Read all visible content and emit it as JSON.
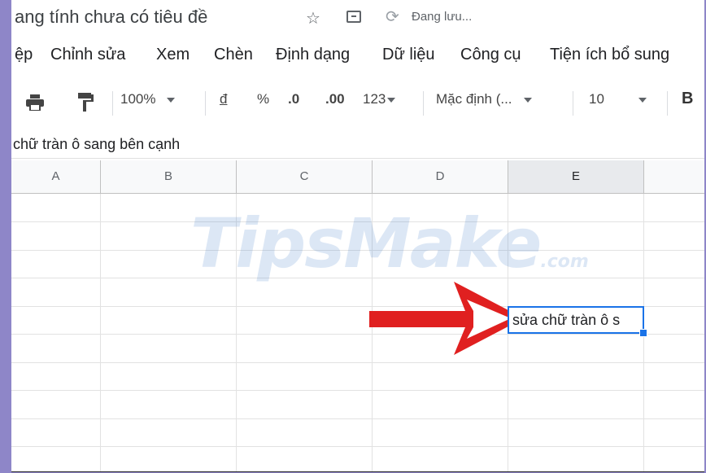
{
  "title_bar": {
    "doc_title": "ang tính chưa có tiêu đề",
    "save_status": "Đang lưu..."
  },
  "menu": [
    {
      "label": "ệp"
    },
    {
      "label": "Chỉnh sửa"
    },
    {
      "label": "Xem"
    },
    {
      "label": "Chèn"
    },
    {
      "label": "Định dạng"
    },
    {
      "label": "Dữ liệu"
    },
    {
      "label": "Công cụ"
    },
    {
      "label": "Tiện ích bổ sung"
    }
  ],
  "toolbar": {
    "zoom": "100%",
    "currency": "đ",
    "percent": "%",
    "decrease_decimal": ".0",
    "increase_decimal": ".00",
    "more_formats": "123",
    "font": "Mặc định (...",
    "font_size": "10",
    "bold": "B"
  },
  "formula_bar": {
    "content": "chữ tràn ô sang bên cạnh"
  },
  "grid": {
    "columns": [
      "A",
      "B",
      "C",
      "D",
      "E"
    ],
    "selected_column": "E",
    "active_cell_text": "sửa chữ tràn ô s"
  },
  "watermark": {
    "text": "TipsMake",
    "suffix": ".com"
  },
  "colors": {
    "accent": "#1a73e8",
    "arrow": "#e02020",
    "frame": "#8e86c8"
  }
}
